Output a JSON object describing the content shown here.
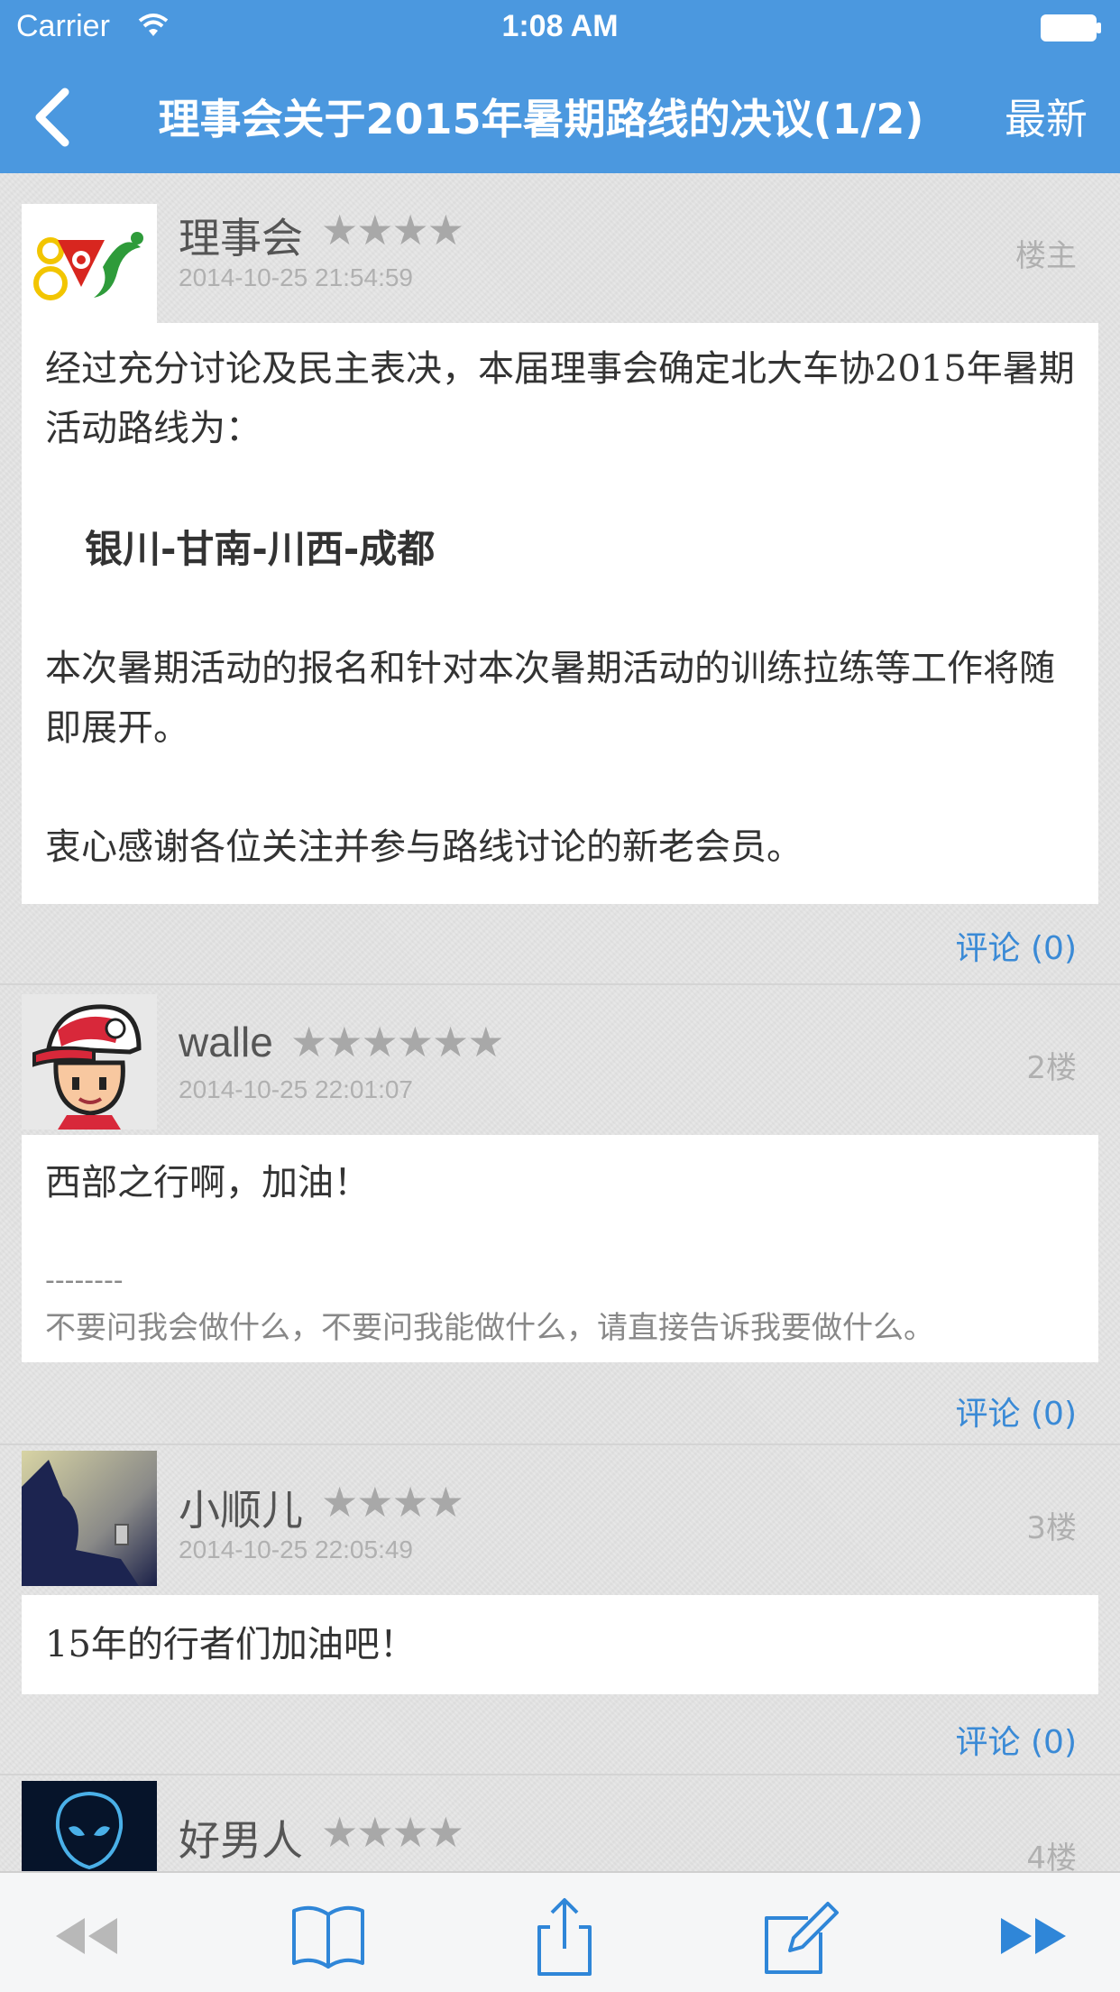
{
  "status": {
    "carrier": "Carrier",
    "time": "1:08 AM"
  },
  "nav": {
    "title": "理事会关于2015年暑期路线的决议(1/2)",
    "latest": "最新"
  },
  "posts": [
    {
      "author": "理事会",
      "stars": "★★★★",
      "time": "2014-10-25 21:54:59",
      "floor": "楼主",
      "paragraphs": [
        "经过充分讨论及民主表决，本届理事会确定北大车协2015年暑期活动路线为：",
        "银川-甘南-川西-成都",
        "本次暑期活动的报名和针对本次暑期活动的训练拉练等工作将随即展开。",
        "衷心感谢各位关注并参与路线讨论的新老会员。"
      ],
      "comment": "评论 (0)"
    },
    {
      "author": "walle",
      "stars": "★★★★★★",
      "time": "2014-10-25 22:01:07",
      "floor": "2楼",
      "text": "西部之行啊，加油！",
      "sig_line": "--------",
      "signature": "不要问我会做什么，不要问我能做什么，请直接告诉我要做什么。",
      "comment": "评论 (0)"
    },
    {
      "author": "小顺儿",
      "stars": "★★★★",
      "time": "2014-10-25 22:05:49",
      "floor": "3楼",
      "text": "15年的行者们加油吧！",
      "comment": "评论 (0)"
    },
    {
      "author": "好男人",
      "stars": "★★★★",
      "floor": "4楼"
    }
  ],
  "icons": {
    "back": "chevron-left-icon",
    "prev": "rewind-icon",
    "bookmark": "book-icon",
    "share": "share-icon",
    "compose": "compose-icon",
    "next": "fast-forward-icon"
  },
  "colors": {
    "nav_bar": "#4b98df",
    "link": "#3a8ad6",
    "star": "#a8a8a8"
  }
}
